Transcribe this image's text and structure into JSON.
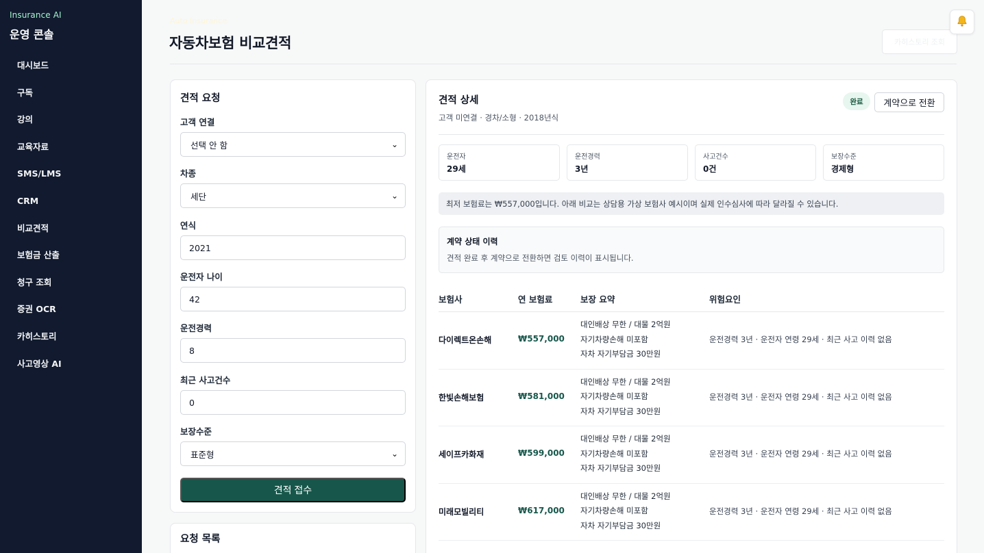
{
  "sidebar": {
    "brand_tag": "Insurance AI",
    "title": "운영 콘솔",
    "items": [
      {
        "label": "대시보드"
      },
      {
        "label": "구독"
      },
      {
        "label": "강의"
      },
      {
        "label": "교육자료"
      },
      {
        "label": "SMS/LMS"
      },
      {
        "label": "CRM"
      },
      {
        "label": "비교견적"
      },
      {
        "label": "보험금 산출"
      },
      {
        "label": "청구 조회"
      },
      {
        "label": "증권 OCR"
      },
      {
        "label": "카히스토리"
      },
      {
        "label": "사고영상 AI"
      }
    ]
  },
  "header": {
    "eyebrow": "Auto Insurance",
    "title": "자동차보험 비교견적",
    "history_button": "카히스토리 조회",
    "bell_icon": "bell-icon"
  },
  "form": {
    "title": "견적 요청",
    "customer_label": "고객 연결",
    "customer_value": "선택 안 함",
    "vehicle_label": "차종",
    "vehicle_value": "세단",
    "year_label": "연식",
    "year_value": "2021",
    "age_label": "운전자 나이",
    "age_value": "42",
    "experience_label": "운전경력",
    "experience_value": "8",
    "accidents_label": "최근 사고건수",
    "accidents_value": "0",
    "coverage_label": "보장수준",
    "coverage_value": "표준형",
    "submit_label": "견적 접수"
  },
  "request_list": {
    "title": "요청 목록"
  },
  "detail": {
    "title": "견적 상세",
    "subtitle": "고객 미연결 · 경차/소형 · 2018년식",
    "status": "완료",
    "convert_button": "계약으로 전환",
    "stats": [
      {
        "label": "운전자",
        "value": "29세"
      },
      {
        "label": "운전경력",
        "value": "3년"
      },
      {
        "label": "사고건수",
        "value": "0건"
      },
      {
        "label": "보장수준",
        "value": "경제형"
      }
    ],
    "notice": "최저 보험료는 ₩557,000입니다. 아래 비교는 상담용 가상 보험사 예시이며 실제 인수심사에 따라 달라질 수 있습니다.",
    "history": {
      "title": "계약 상태 이력",
      "text": "견적 완료 후 계약으로 전환하면 검토 이력이 표시됩니다."
    },
    "table": {
      "headers": [
        "보험사",
        "연 보험료",
        "보장 요약",
        "위험요인"
      ],
      "rows": [
        {
          "insurer": "다이렉트온손해",
          "premium": "₩557,000",
          "coverage": [
            "대인배상 무한 / 대물 2억원",
            "자기차량손해 미포함",
            "자차 자기부담금 30만원"
          ],
          "risk": "운전경력 3년 · 운전자 연령 29세 · 최근 사고 이력 없음"
        },
        {
          "insurer": "한빛손해보험",
          "premium": "₩581,000",
          "coverage": [
            "대인배상 무한 / 대물 2억원",
            "자기차량손해 미포함",
            "자차 자기부담금 30만원"
          ],
          "risk": "운전경력 3년 · 운전자 연령 29세 · 최근 사고 이력 없음"
        },
        {
          "insurer": "세이프카화재",
          "premium": "₩599,000",
          "coverage": [
            "대인배상 무한 / 대물 2억원",
            "자기차량손해 미포함",
            "자차 자기부담금 30만원"
          ],
          "risk": "운전경력 3년 · 운전자 연령 29세 · 최근 사고 이력 없음"
        },
        {
          "insurer": "미래모빌리티",
          "premium": "₩617,000",
          "coverage": [
            "대인배상 무한 / 대물 2억원",
            "자기차량손해 미포함",
            "자차 자기부담금 30만원"
          ],
          "risk": "운전경력 3년 · 운전자 연령 29세 · 최근 사고 이력 없음"
        }
      ]
    }
  },
  "colors": {
    "sidebar_bg": "#111a2e",
    "accent": "#17574b",
    "brand_tag": "#a7f3d0",
    "badge_bg": "#e7f6ee"
  }
}
